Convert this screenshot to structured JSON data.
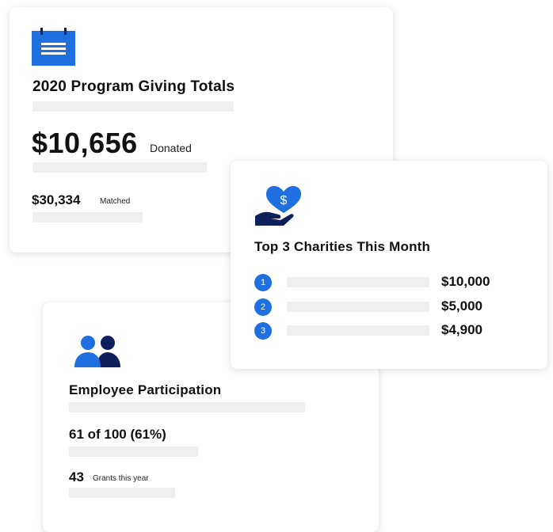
{
  "colors": {
    "accent_blue": "#1f6fe0",
    "navy": "#0f1f5c",
    "placeholder_bar": "#efefef"
  },
  "giving_card": {
    "icon": "calendar-icon",
    "title": "2020 Program Giving Totals",
    "donated_amount": "$10,656",
    "donated_label": "Donated",
    "matched_amount": "$30,334",
    "matched_label": "Matched"
  },
  "charities_card": {
    "icon": "heart-hand-dollar-icon",
    "title": "Top 3 Charities This Month",
    "items": [
      {
        "rank": "1",
        "amount": "$10,000"
      },
      {
        "rank": "2",
        "amount": "$5,000"
      },
      {
        "rank": "3",
        "amount": "$4,900"
      }
    ]
  },
  "participation_card": {
    "icon": "people-icon",
    "title": "Employee Participation",
    "stat": "61 of 100 (61%)",
    "grants_count": "43",
    "grants_label": "Grants this year"
  }
}
